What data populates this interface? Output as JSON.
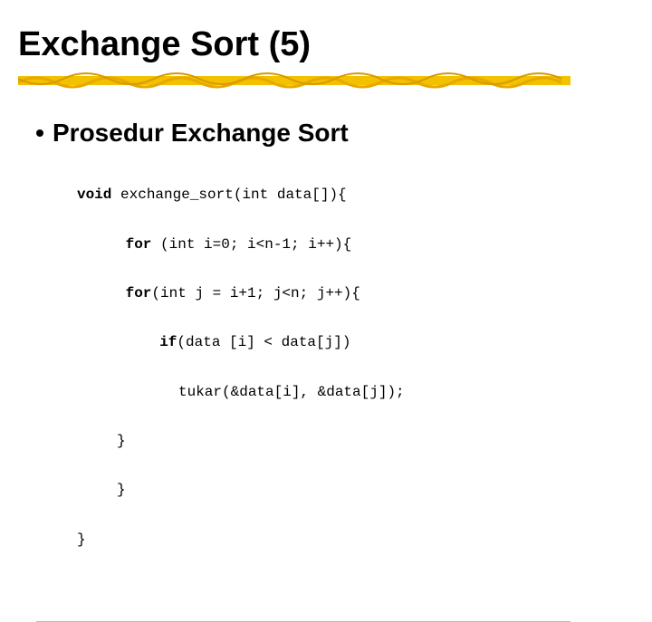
{
  "title": "Exchange Sort (5)",
  "bullet": {
    "text": "Prosedur Exchange Sort"
  },
  "code": {
    "l1_kw": "void",
    "l1_rest": " exchange_sort(int data[]){",
    "l2_kw": " for",
    "l2_rest": " (int i=0; i<n-1; i++){",
    "l3_kw": " for",
    "l3_rest": "(int j = i+1; j<n; j++){",
    "l4_kw": "  if",
    "l4_rest": "(data [i] < data[j])",
    "l5": "tukar(&data[i], &data[j]);",
    "l6": "}",
    "l7": "}",
    "l8": "}"
  }
}
